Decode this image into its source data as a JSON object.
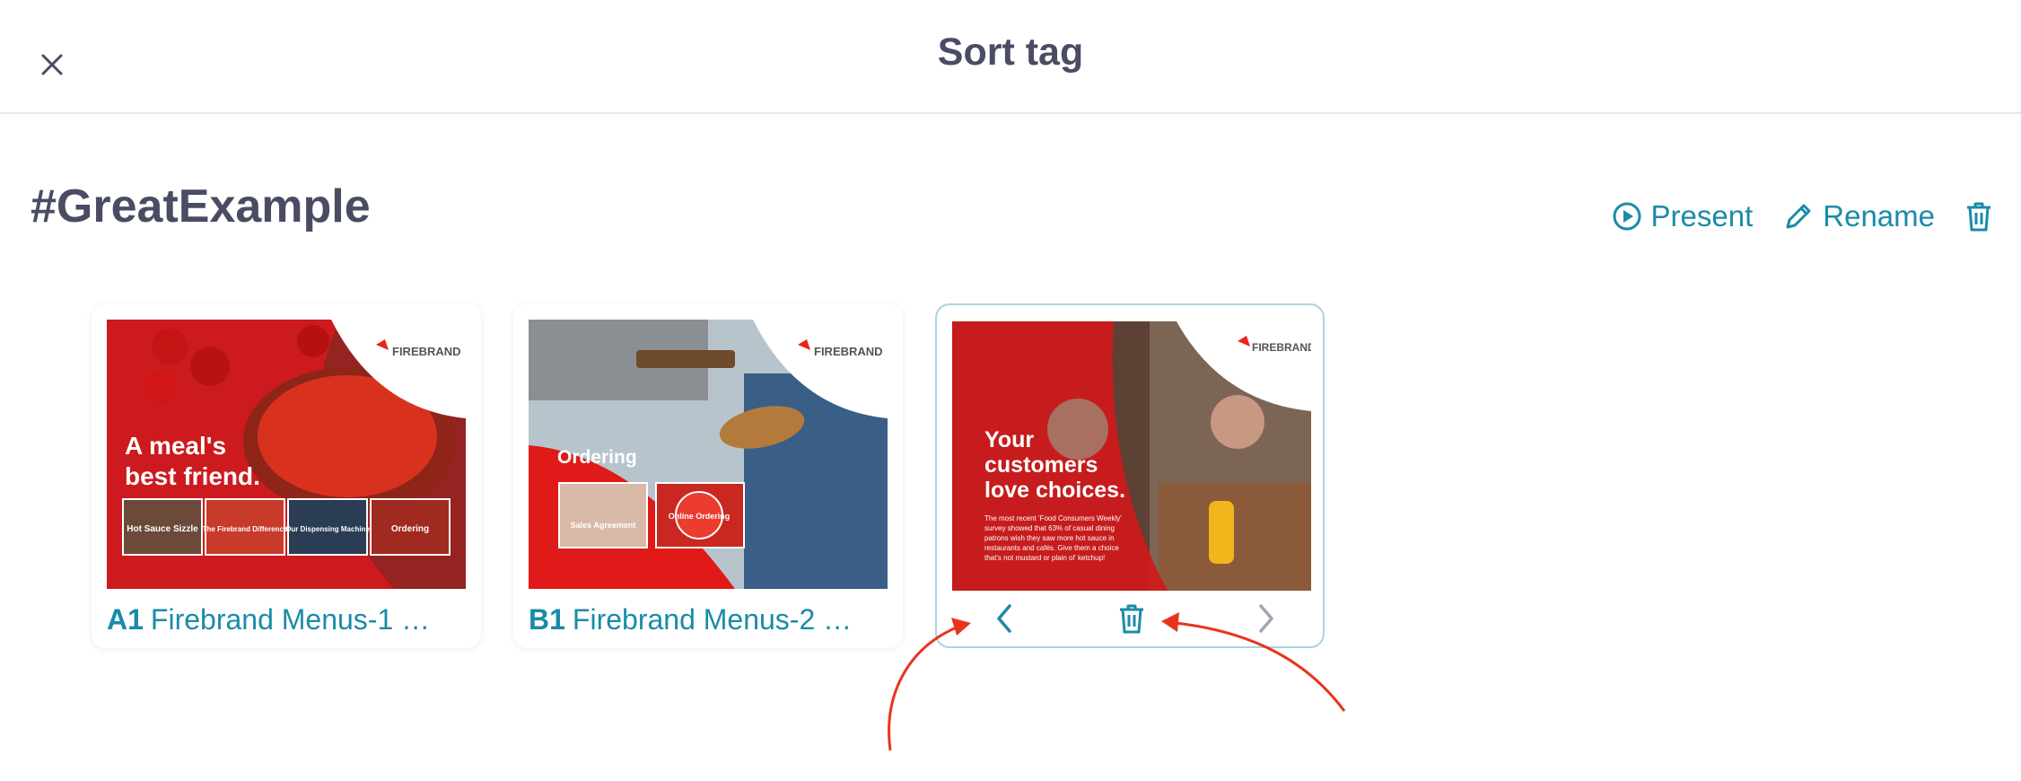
{
  "header": {
    "title": "Sort tag"
  },
  "tag": {
    "name": "#GreatExample"
  },
  "actions": {
    "present": "Present",
    "rename": "Rename"
  },
  "cards": [
    {
      "code": "A1",
      "title": "Firebrand Menus-1 …",
      "headline_1": "A meal's",
      "headline_2": "best friend.",
      "brand": "FIREBRAND",
      "tiles": [
        "Hot Sauce Sizzle",
        "The Firebrand Difference",
        "Our Dispensing Machine",
        "Ordering"
      ]
    },
    {
      "code": "B1",
      "title": "Firebrand Menus-2 …",
      "headline": "Ordering",
      "brand": "FIREBRAND",
      "tiles": [
        "Sales Agreement",
        "Online Ordering"
      ]
    },
    {
      "headline_1": "Your",
      "headline_2": "customers",
      "headline_3": "love choices.",
      "brand": "FIREBRAND",
      "body_1": "The most recent 'Food Consumers Weekly'",
      "body_2": "survey showed that 63% of casual dining",
      "body_3": "patrons wish they saw more hot sauce in",
      "body_4": "restaurants and cafés. Give them a choice",
      "body_5": "that's not mustard or plain ol' ketchup!"
    }
  ],
  "colors": {
    "accent": "#1a8ba8",
    "title": "#4a4c63",
    "brand_red": "#e8241a",
    "annotation": "#e8341c"
  }
}
